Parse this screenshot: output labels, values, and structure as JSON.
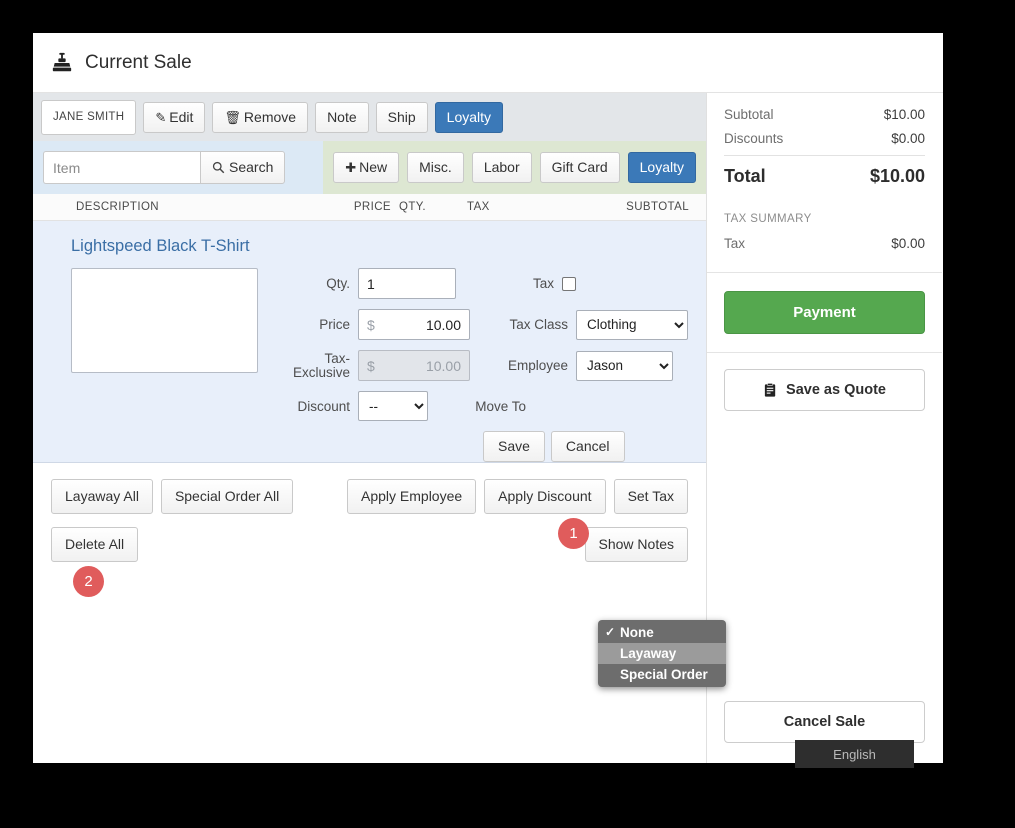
{
  "window": {
    "title": "Current Sale",
    "title_icon": "cash-register-icon"
  },
  "customer_toolbar": {
    "customer_name": "JANE SMITH",
    "edit": "Edit",
    "remove": "Remove",
    "note": "Note",
    "ship": "Ship",
    "loyalty": "Loyalty"
  },
  "search_row": {
    "item_placeholder": "Item",
    "item_value": "",
    "search": "Search",
    "new": "New",
    "misc": "Misc.",
    "labor": "Labor",
    "gift_card": "Gift Card",
    "loyalty": "Loyalty"
  },
  "columns": {
    "description": "DESCRIPTION",
    "price": "PRICE",
    "qty": "QTY.",
    "tax": "TAX",
    "subtotal": "SUBTOTAL"
  },
  "item": {
    "name": "Lightspeed Black T-Shirt",
    "note_value": "",
    "qty_label": "Qty.",
    "qty_value": "1",
    "price_label": "Price",
    "price_currency": "$",
    "price_value": "10.00",
    "tax_exclusive_label": "Tax-Exclusive",
    "tax_exclusive_currency": "$",
    "tax_exclusive_value": "10.00",
    "discount_label": "Discount",
    "discount_value": "--",
    "tax_label": "Tax",
    "tax_checked": false,
    "tax_class_label": "Tax Class",
    "tax_class_value": "Clothing",
    "employee_label": "Employee",
    "employee_value": "Jason",
    "move_to_label": "Move To",
    "save": "Save",
    "cancel": "Cancel"
  },
  "move_to_menu": {
    "options": [
      {
        "label": "None",
        "checked": true,
        "highlighted": false
      },
      {
        "label": "Layaway",
        "checked": false,
        "highlighted": true
      },
      {
        "label": "Special Order",
        "checked": false,
        "highlighted": false
      }
    ],
    "check_glyph": "✓"
  },
  "actions": {
    "layaway_all": "Layaway All",
    "special_order_all": "Special Order All",
    "apply_employee": "Apply Employee",
    "apply_discount": "Apply Discount",
    "set_tax": "Set Tax",
    "delete_all": "Delete All",
    "show_notes": "Show Notes"
  },
  "summary": {
    "subtotal_label": "Subtotal",
    "subtotal_value": "$10.00",
    "discounts_label": "Discounts",
    "discounts_value": "$0.00",
    "total_label": "Total",
    "total_value": "$10.00",
    "tax_summary_label": "TAX SUMMARY",
    "tax_label": "Tax",
    "tax_value": "$0.00",
    "payment": "Payment",
    "save_as_quote": "Save as Quote",
    "cancel_sale": "Cancel Sale"
  },
  "overlay": {
    "language": "English"
  },
  "annotations": {
    "badge1": "1",
    "badge2": "2"
  },
  "colors": {
    "accent_blue": "#3b79b8",
    "payment_green": "#55a84f",
    "badge_red": "#e05c5c",
    "item_panel_blue": "#e8effa",
    "search_left_blue": "#dce9f5",
    "search_right_green": "#dde7d2",
    "menu_gray": "#6d6d6d",
    "menu_highlight": "#9b9b9b"
  }
}
